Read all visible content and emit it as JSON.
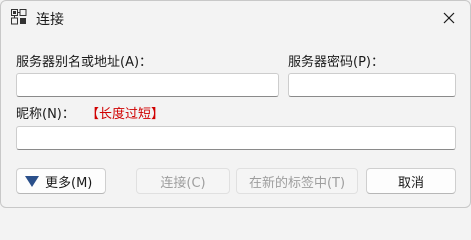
{
  "window": {
    "title": "连接",
    "icon": "connect-network-icon",
    "close_icon": "close-icon"
  },
  "form": {
    "server_label": "服务器别名或地址(A)：",
    "server_value": "",
    "password_label": "服务器密码(P)：",
    "password_value": "",
    "nickname_label": "昵称(N)：",
    "nickname_warning": "【长度过短】",
    "nickname_value": "",
    "warning_color": "#d00000"
  },
  "buttons": {
    "more_label": "更多(M)",
    "more_icon": "triangle-down-icon",
    "connect_label": "连接(C)",
    "new_tab_label": "在新的标签中(T)",
    "cancel_label": "取消"
  }
}
